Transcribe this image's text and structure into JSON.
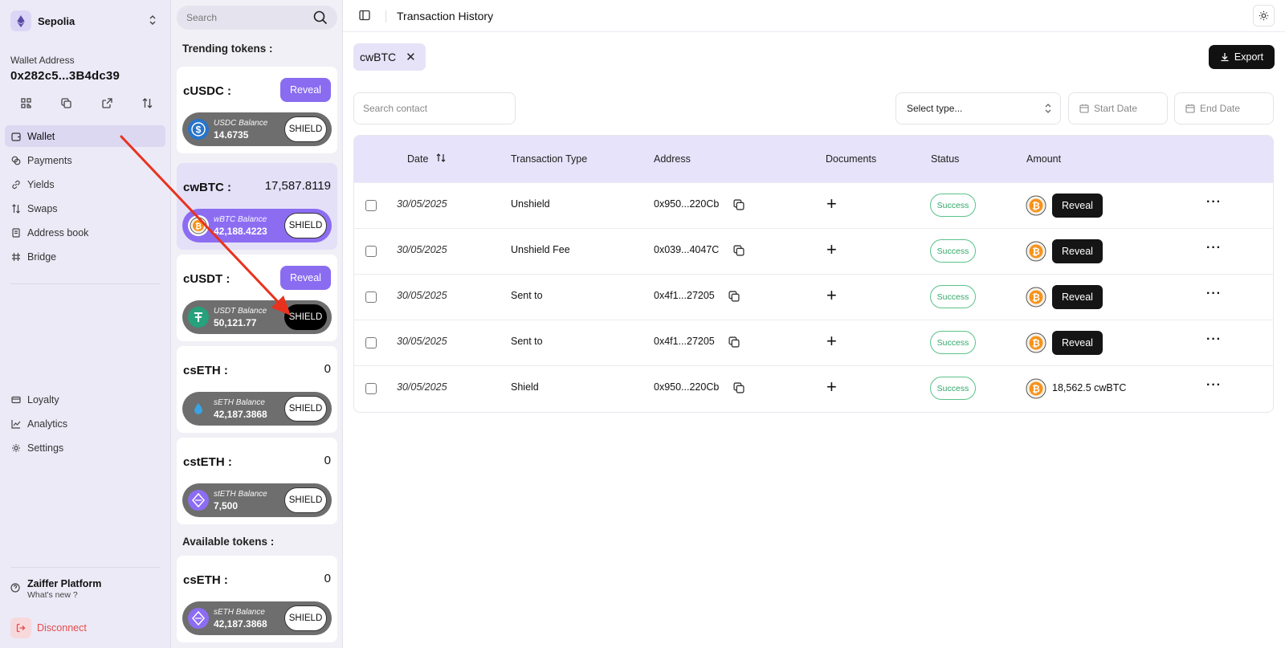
{
  "sidebar": {
    "network": "Sepolia",
    "wallet_label": "Wallet Address",
    "wallet_address": "0x282c5...3B4dc39",
    "nav_main": [
      {
        "label": "Wallet",
        "icon": "wallet-icon",
        "active": true
      },
      {
        "label": "Payments",
        "icon": "payments-icon"
      },
      {
        "label": "Yields",
        "icon": "yields-icon"
      },
      {
        "label": "Swaps",
        "icon": "swap-icon"
      },
      {
        "label": "Address book",
        "icon": "address-book-icon"
      },
      {
        "label": "Bridge",
        "icon": "bridge-icon"
      }
    ],
    "nav_bottom": [
      {
        "label": "Loyalty",
        "icon": "loyalty-icon"
      },
      {
        "label": "Analytics",
        "icon": "analytics-icon"
      },
      {
        "label": "Settings",
        "icon": "settings-icon"
      }
    ],
    "platform_title": "Zaiffer Platform",
    "platform_sub": "What's new ?",
    "disconnect": "Disconnect"
  },
  "tokens": {
    "search_placeholder": "Search",
    "trending_label": "Trending tokens :",
    "available_label": "Available tokens :",
    "shield_label": "SHIELD",
    "reveal_label": "Reveal",
    "trending": [
      {
        "name": "cUSDC :",
        "value": "",
        "reveal": true,
        "balance_label": "USDC Balance",
        "balance": "14.6735",
        "coin": "usdc"
      },
      {
        "name": "cwBTC :",
        "value": "17,587.8119",
        "reveal": false,
        "selected": true,
        "balance_label": "wBTC Balance",
        "balance": "42,188.4223",
        "coin": "wbtc"
      },
      {
        "name": "cUSDT :",
        "value": "",
        "reveal": true,
        "balance_label": "USDT Balance",
        "balance": "50,121.77",
        "coin": "usdt",
        "shield_dark": true
      },
      {
        "name": "csETH :",
        "value": "0",
        "reveal": false,
        "balance_label": "sETH Balance",
        "balance": "42,187.3868",
        "coin": "seth"
      },
      {
        "name": "cstETH :",
        "value": "0",
        "reveal": false,
        "balance_label": "stETH Balance",
        "balance": "7,500",
        "coin": "steth"
      }
    ],
    "available": [
      {
        "name": "csETH :",
        "value": "0",
        "reveal": false,
        "balance_label": "sETH Balance",
        "balance": "42,187.3868",
        "coin": "seth2"
      }
    ]
  },
  "main": {
    "title": "Transaction History",
    "filter_chip": "cwBTC",
    "export_label": "Export",
    "search_placeholder": "Search contact",
    "select_type": "Select type...",
    "start_date": "Start Date",
    "end_date": "End Date",
    "columns": [
      "Date",
      "Transaction Type",
      "Address",
      "Documents",
      "Status",
      "Amount"
    ],
    "reveal_label": "Reveal",
    "rows": [
      {
        "date": "30/05/2025",
        "type": "Unshield",
        "address": "0x950...220Cb",
        "status": "Success",
        "amount": ""
      },
      {
        "date": "30/05/2025",
        "type": "Unshield Fee",
        "address": "0x039...4047C",
        "status": "Success",
        "amount": ""
      },
      {
        "date": "30/05/2025",
        "type": "Sent to",
        "address": "0x4f1...27205",
        "status": "Success",
        "amount": ""
      },
      {
        "date": "30/05/2025",
        "type": "Sent to",
        "address": "0x4f1...27205",
        "status": "Success",
        "amount": ""
      },
      {
        "date": "30/05/2025",
        "type": "Shield",
        "address": "0x950...220Cb",
        "status": "Success",
        "amount": "18,562.5 cwBTC"
      }
    ]
  },
  "colors": {
    "accent": "#8A6CF0",
    "sidebar_bg": "#ECEAF7",
    "table_header": "#E6E3FA",
    "success": "#33A86A",
    "annotation_arrow": "#E8321E"
  }
}
